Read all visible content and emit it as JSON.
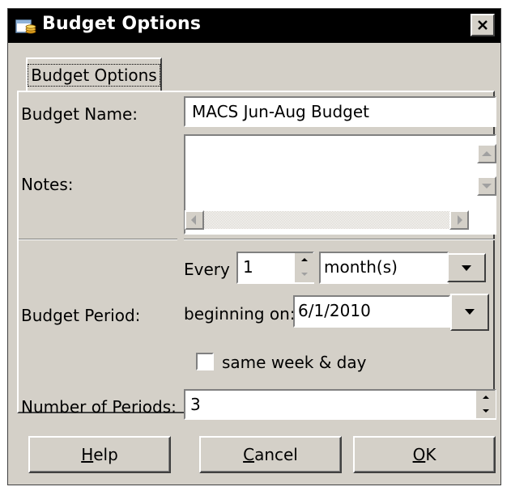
{
  "window": {
    "title": "Budget Options",
    "close_glyph": "✕",
    "icon": "budget-folder-icon"
  },
  "tab": {
    "label": "Budget Options"
  },
  "fields": {
    "budget_name_label": "Budget Name:",
    "budget_name_value": "MACS Jun-Aug Budget",
    "notes_label": "Notes:",
    "notes_value": "",
    "budget_period_label": "Budget Period:",
    "every_label": "Every",
    "every_value": "1",
    "period_unit_value": "month(s)",
    "beginning_label": "beginning on:",
    "beginning_value": "6/1/2010",
    "same_week_label": "same week & day",
    "same_week_checked": false,
    "num_periods_label": "Number of Periods:",
    "num_periods_value": "3"
  },
  "buttons": {
    "help": {
      "mnemonic": "H",
      "rest": "elp"
    },
    "cancel": {
      "mnemonic": "C",
      "rest": "ancel"
    },
    "ok": {
      "mnemonic": "O",
      "rest": "K"
    }
  },
  "colors": {
    "dialog_bg": "#d4d0c8",
    "titlebar_bg": "#000000",
    "title_text": "#ffffff",
    "field_bg": "#ffffff"
  }
}
